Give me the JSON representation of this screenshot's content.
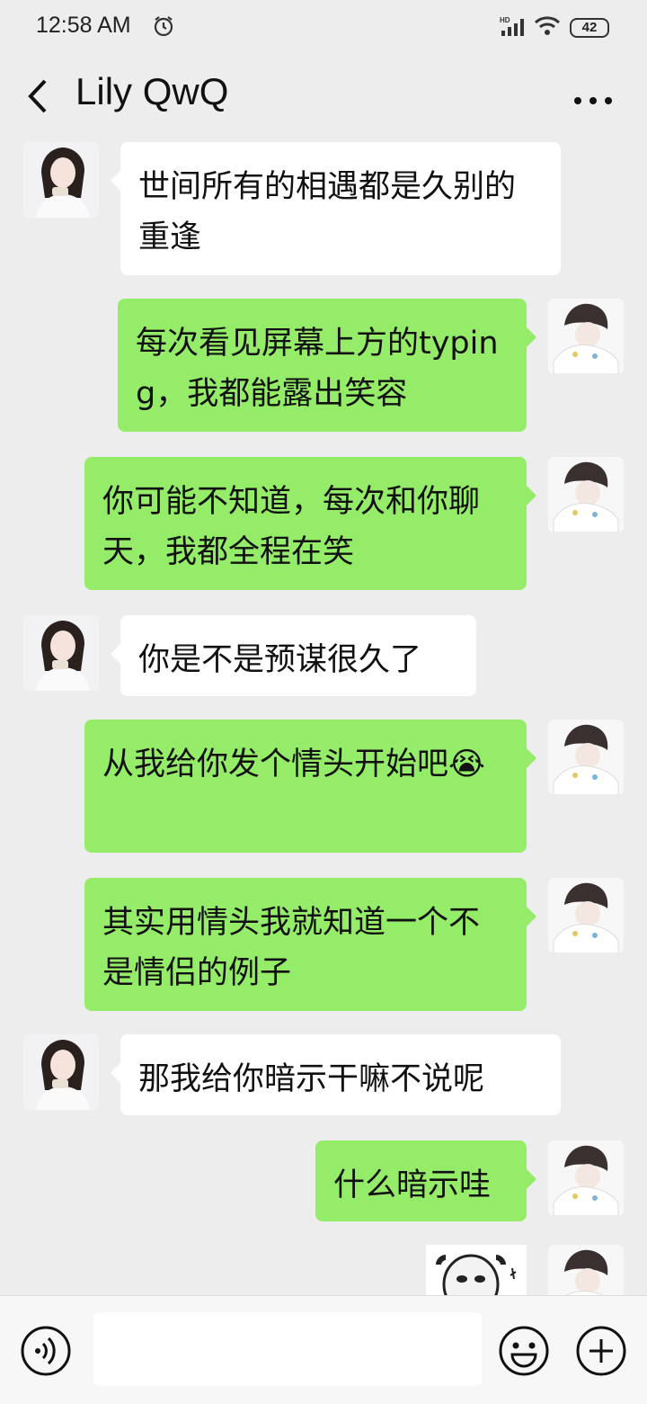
{
  "status_bar": {
    "time": "12:58 AM",
    "network": "HD",
    "battery": "42"
  },
  "header": {
    "title": "Lily QwQ"
  },
  "messages": [
    {
      "side": "in",
      "text": "世间所有的相遇都是久别的重逢"
    },
    {
      "side": "out",
      "text": "每次看见屏幕上方的typing，我都能露出笑容"
    },
    {
      "side": "out",
      "text": "你可能不知道，每次和你聊天，我都全程在笑"
    },
    {
      "side": "in",
      "text": "你是不是预谋很久了"
    },
    {
      "side": "out",
      "text": "从我给你发个情头开始吧",
      "emoji": "😭"
    },
    {
      "side": "out",
      "text": "其实用情头我就知道一个不是情侣的例子"
    },
    {
      "side": "in",
      "text": "那我给你暗示干嘛不说呢"
    },
    {
      "side": "out",
      "text": "什么暗示哇"
    },
    {
      "side": "out",
      "type": "sticker"
    }
  ],
  "colors": {
    "background": "#ededed",
    "bubble_in": "#ffffff",
    "bubble_out": "#95ec69"
  },
  "icons": [
    "alarm-icon",
    "signal-icon",
    "wifi-icon",
    "battery-icon",
    "back-arrow-icon",
    "more-icon",
    "voice-icon",
    "emoji-icon",
    "plus-icon"
  ]
}
